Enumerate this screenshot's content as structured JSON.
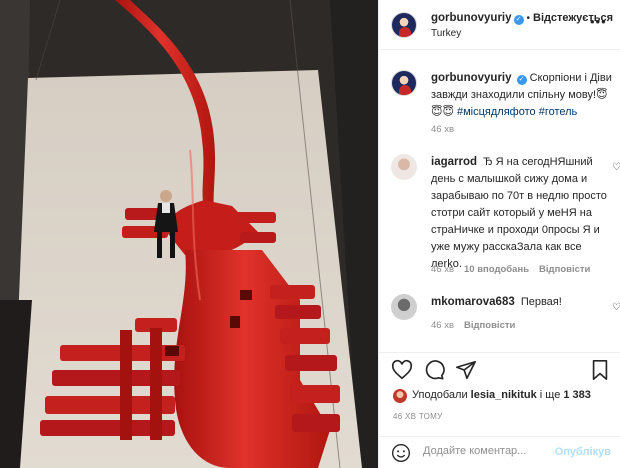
{
  "header": {
    "username": "gorbunovyuriy",
    "separator": "•",
    "follow_label": "Відстежується",
    "location": "Turkey",
    "more_icon": "more-options-icon"
  },
  "caption": {
    "username": "gorbunovyuriy",
    "text": "Скорпіони і Діви завжди знаходили спільну мову!😇😇😇",
    "tags": [
      "#місцядляфото",
      "#готель"
    ],
    "time": "46 хв"
  },
  "comments": [
    {
      "username": "iagarrod",
      "text": "Ђ Я на сегодНЯшний день с малышкой сижу дома и зарабываю по 70т в недлю просто стотри сайт который у меНЯ на страНичке и проходи 0просы Я и уже мужу расскаЗала как все лerko.",
      "time": "46 хв",
      "likes": "10 вподобань",
      "reply": "Відповісти"
    },
    {
      "username": "mkomarova683",
      "text": "Первая!",
      "time": "46 хв",
      "reply": "Відповісти"
    }
  ],
  "likes": {
    "prefix": "Уподобали",
    "user": "lesia_nikituk",
    "suffix": "і ще",
    "count": "1 383"
  },
  "post_time": "46 ХВ ТОМУ",
  "comment_box": {
    "placeholder": "Додайте коментар...",
    "publish_label": "Опублікув"
  },
  "colors": {
    "accent_link": "#00376b",
    "publish_disabled": "#b2dffc",
    "secondary_text": "#8e8e8e",
    "verified": "#3897f0",
    "sculpture_red": "#c8201e"
  }
}
